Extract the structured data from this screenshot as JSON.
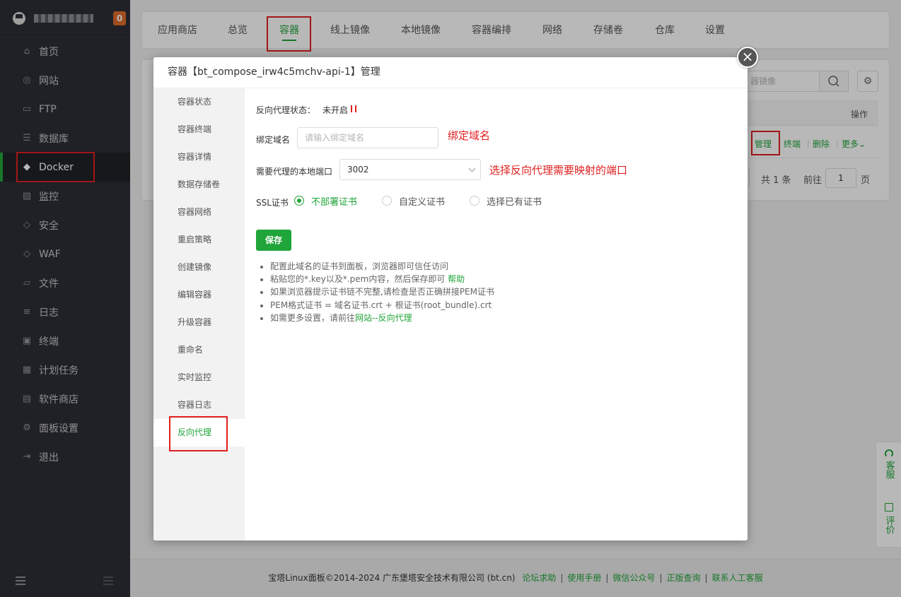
{
  "sidebar": {
    "badge": "0",
    "items": [
      {
        "label": "首页",
        "icon": "⌂"
      },
      {
        "label": "网站",
        "icon": "◎"
      },
      {
        "label": "FTP",
        "icon": "▭"
      },
      {
        "label": "数据库",
        "icon": "☰"
      },
      {
        "label": "Docker",
        "icon": "◆"
      },
      {
        "label": "监控",
        "icon": "▨"
      },
      {
        "label": "安全",
        "icon": "◇"
      },
      {
        "label": "WAF",
        "icon": "◇"
      },
      {
        "label": "文件",
        "icon": "▱"
      },
      {
        "label": "日志",
        "icon": "≡"
      },
      {
        "label": "终端",
        "icon": "▣"
      },
      {
        "label": "计划任务",
        "icon": "▦"
      },
      {
        "label": "软件商店",
        "icon": "▤"
      },
      {
        "label": "面板设置",
        "icon": "⚙"
      },
      {
        "label": "退出",
        "icon": "⇥"
      }
    ]
  },
  "tabs": [
    "应用商店",
    "总览",
    "容器",
    "线上镜像",
    "本地镜像",
    "容器编排",
    "网络",
    "存储卷",
    "仓库",
    "设置"
  ],
  "background": {
    "search_placeholder": "器镜像",
    "gear_icon": "⚙",
    "table_op_header": "操作",
    "row_actions": [
      "管理",
      "终端",
      "删除",
      "更多"
    ],
    "pager_total": "共 1 条",
    "pager_goto": "前往",
    "pager_page": "1",
    "pager_unit": "页"
  },
  "modal": {
    "title": "容器【bt_compose_irw4c5mchv-api-1】管理",
    "close_icon": "×",
    "nav": [
      "容器状态",
      "容器终端",
      "容器详情",
      "数据存储卷",
      "容器网络",
      "重启策略",
      "创建镜像",
      "编辑容器",
      "升级容器",
      "重命名",
      "实时监控",
      "容器日志",
      "反向代理"
    ],
    "form": {
      "status_label": "反向代理状态：",
      "status_value": "未开启",
      "domain_label": "绑定域名",
      "domain_placeholder": "请输入绑定域名",
      "domain_note": "绑定域名",
      "port_label": "需要代理的本地端口",
      "port_value": "3002",
      "port_note": "选择反向代理需要映射的端口",
      "ssl_label": "SSL证书",
      "ssl_options": [
        "不部署证书",
        "自定义证书",
        "选择已有证书"
      ],
      "save_label": "保存"
    },
    "tips": {
      "t1": "配置此域名的证书到面板，浏览器即可信任访问",
      "t2": "粘贴您的*.key以及*.pem内容，然后保存即可",
      "t2_link": "帮助",
      "t3": "如果浏览器提示证书链不完整,请检查是否正确拼接PEM证书",
      "t4": "PEM格式证书 = 域名证书.crt + 根证书(root_bundle).crt",
      "t5": "如需更多设置，请前往",
      "t5_link": "网站--反向代理"
    }
  },
  "footer": {
    "copyright": "宝塔Linux面板©2014-2024 广东堡塔安全技术有限公司 (bt.cn)",
    "links": [
      "论坛求助",
      "使用手册",
      "微信公众号",
      "正版查询",
      "联系人工客服"
    ]
  },
  "float": {
    "service": "客服",
    "review": "评价"
  }
}
